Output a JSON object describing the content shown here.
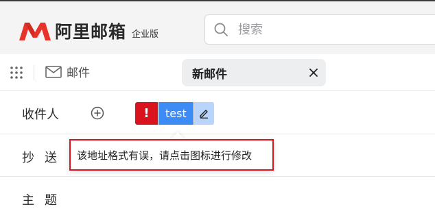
{
  "app": {
    "logo_text": "阿里邮箱",
    "edition": "企业版",
    "brand_color": "#e8332a"
  },
  "search": {
    "placeholder": "搜索",
    "icon": "search-icon"
  },
  "tabs": {
    "apps_icon": "grid-icon",
    "mail_label": "邮件",
    "compose_label": "新邮件"
  },
  "compose": {
    "to_label": "收件人",
    "cc_label": "抄送",
    "subject_label": "主题",
    "recipients": [
      {
        "name": "test",
        "error_mark": "!",
        "status": "invalid",
        "status_color": "#d9141f"
      }
    ],
    "error_tooltip": "该地址格式有误，请点击图标进行修改"
  }
}
